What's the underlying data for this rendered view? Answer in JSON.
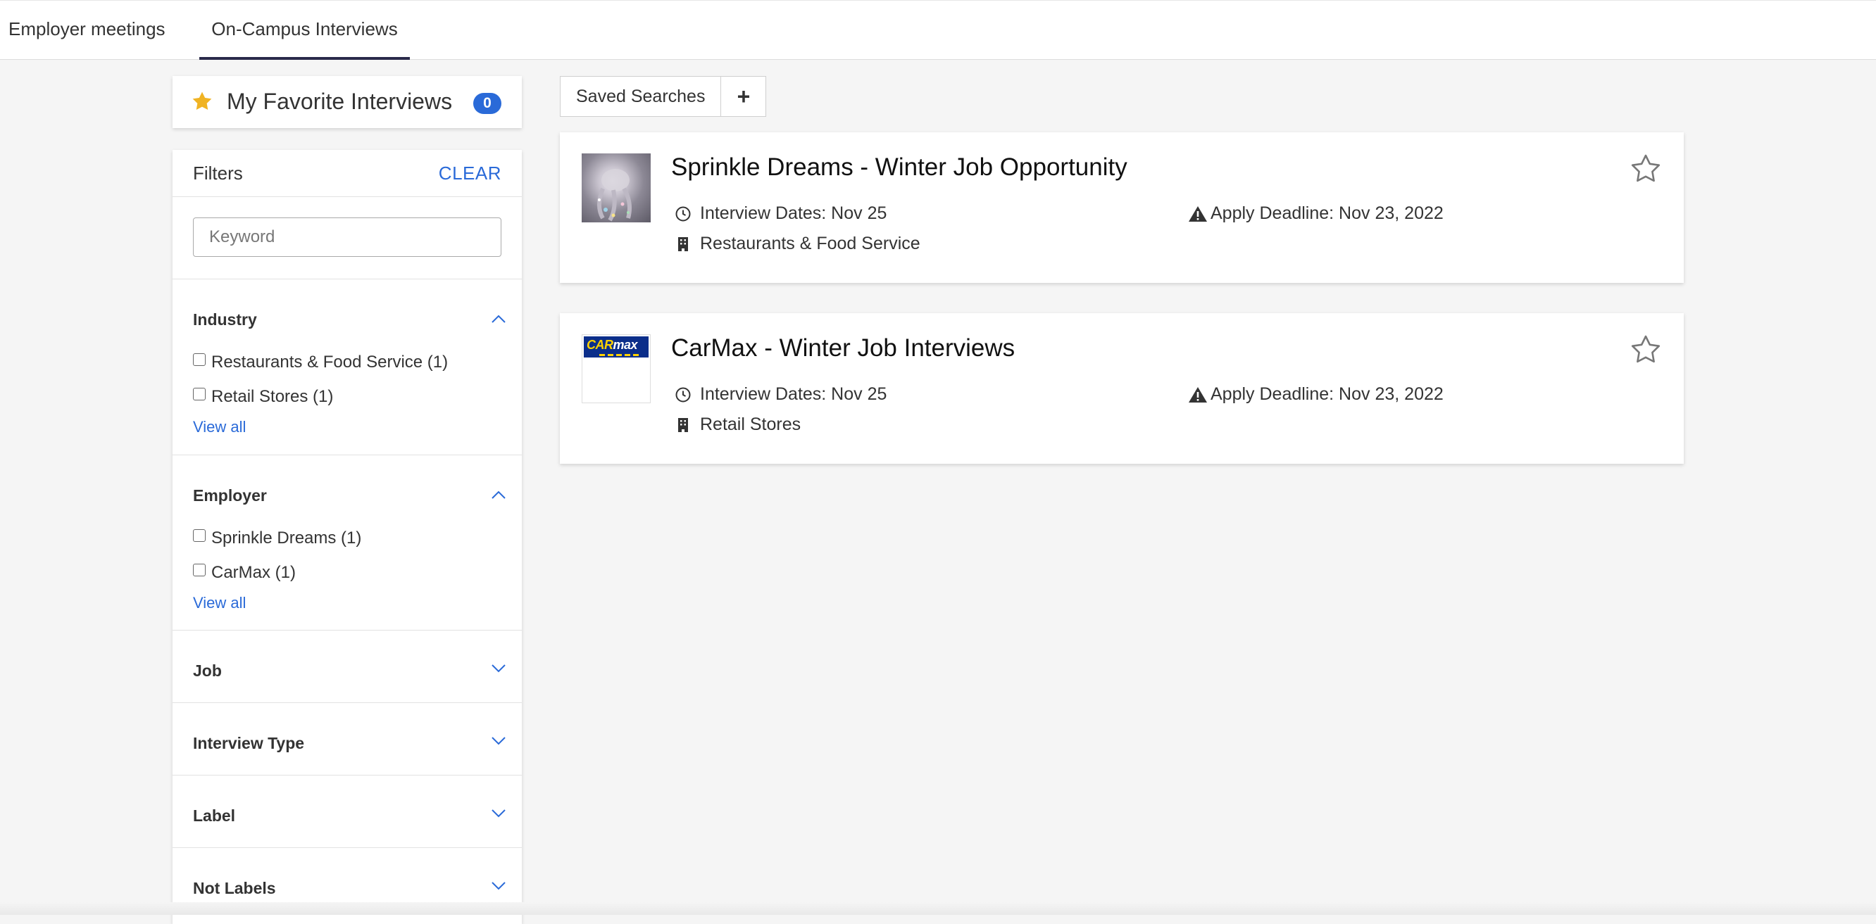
{
  "tabs": [
    {
      "label": "Employer meetings",
      "active": false
    },
    {
      "label": "On-Campus Interviews",
      "active": true
    }
  ],
  "favorites": {
    "title": "My Favorite Interviews",
    "count": "0"
  },
  "filters": {
    "title": "Filters",
    "clear_label": "CLEAR",
    "keyword_placeholder": "Keyword",
    "industry": {
      "title": "Industry",
      "options": [
        "Restaurants & Food Service (1)",
        "Retail Stores (1)"
      ],
      "view_all": "View all"
    },
    "employer": {
      "title": "Employer",
      "options": [
        "Sprinkle Dreams (1)",
        "CarMax (1)"
      ],
      "view_all": "View all"
    },
    "collapsed": [
      "Job",
      "Interview Type",
      "Label",
      "Not Labels"
    ]
  },
  "toolbar": {
    "saved_searches_label": "Saved Searches",
    "add_label": "+"
  },
  "jobs": [
    {
      "title": "Sprinkle Dreams - Winter Job Opportunity",
      "interview_dates": "Interview Dates: Nov 25",
      "deadline": "Apply Deadline: Nov 23, 2022",
      "industry": "Restaurants & Food Service"
    },
    {
      "title": "CarMax - Winter Job Interviews",
      "interview_dates": "Interview Dates: Nov 25",
      "deadline": "Apply Deadline: Nov 23, 2022",
      "industry": "Retail Stores",
      "logo_text": {
        "car": "CAR",
        "max": "max"
      }
    }
  ],
  "colors": {
    "accent": "#2a6ad8",
    "star_gold": "#f0b323",
    "tab_underline": "#2a2a4a"
  }
}
